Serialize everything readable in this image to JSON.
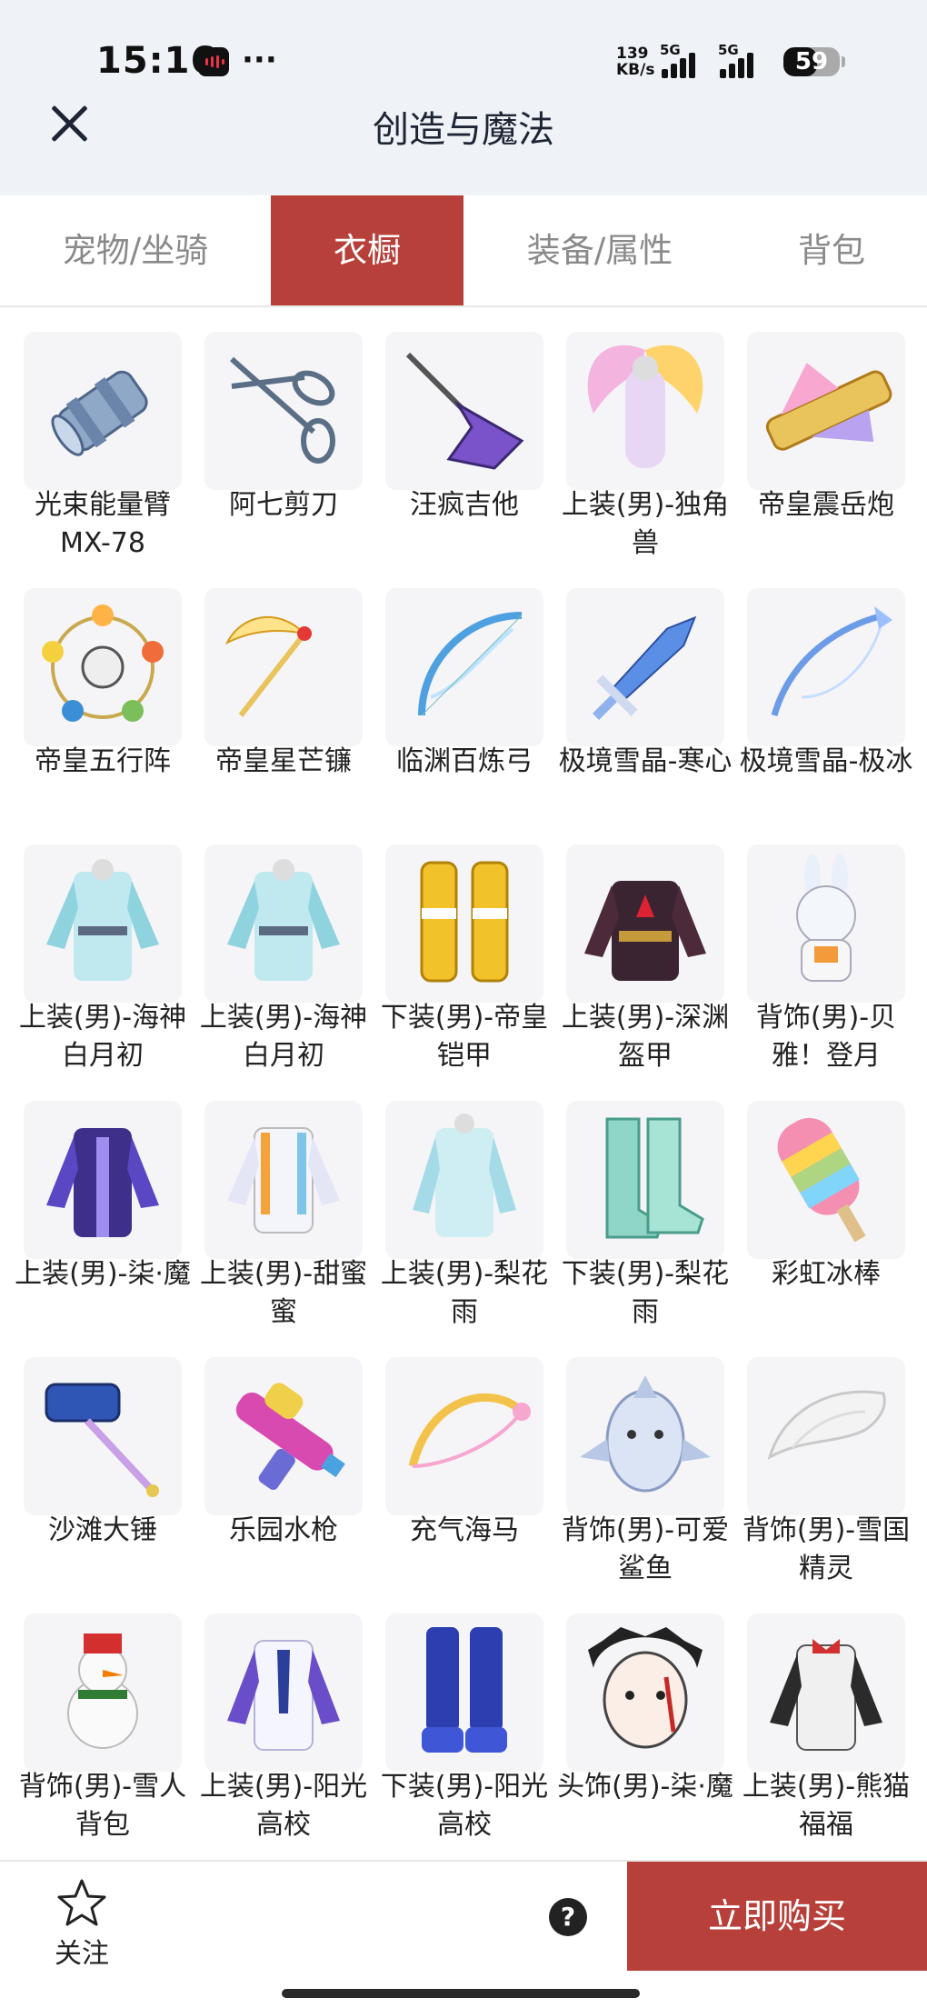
{
  "status_bar": {
    "time": "15:16",
    "net_speed_value": "139",
    "net_speed_unit": "KB/s",
    "network_1": "5G",
    "network_2": "5G",
    "battery": "59",
    "battery_level": 0.59
  },
  "header": {
    "title": "创造与魔法"
  },
  "tabs": [
    {
      "label": "宠物/坐骑",
      "active": false
    },
    {
      "label": "衣橱",
      "active": true
    },
    {
      "label": "装备/属性",
      "active": false
    },
    {
      "label": "背包",
      "active": false
    }
  ],
  "items": [
    {
      "name": "光束能量臂MX-78",
      "icon": "beam-arm-icon"
    },
    {
      "name": "阿七剪刀",
      "icon": "scissors-icon"
    },
    {
      "name": "汪疯吉他",
      "icon": "guitar-icon"
    },
    {
      "name": "上装(男)-独角兽",
      "icon": "unicorn-outfit-icon"
    },
    {
      "name": "帝皇震岳炮",
      "icon": "cannon-icon"
    },
    {
      "name": "帝皇五行阵",
      "icon": "five-elements-ring-icon"
    },
    {
      "name": "帝皇星芒镰",
      "icon": "scythe-icon"
    },
    {
      "name": "临渊百炼弓",
      "icon": "bow-icon"
    },
    {
      "name": "极境雪晶-寒心",
      "icon": "ice-sword-icon"
    },
    {
      "name": "极境雪晶-极冰",
      "icon": "ice-bow-icon"
    },
    {
      "name": "上装(男)-海神白月初",
      "icon": "robe-icon"
    },
    {
      "name": "上装(男)-海神白月初",
      "icon": "robe-icon"
    },
    {
      "name": "下装(男)-帝皇铠甲",
      "icon": "gold-pants-icon"
    },
    {
      "name": "上装(男)-深渊盔甲",
      "icon": "dark-armor-icon"
    },
    {
      "name": "背饰(男)-贝雅！登月",
      "icon": "bunny-astronaut-icon"
    },
    {
      "name": "上装(男)-柒·魔",
      "icon": "purple-coat-icon"
    },
    {
      "name": "上装(男)-甜蜜蜜",
      "icon": "white-shirt-icon"
    },
    {
      "name": "上装(男)-梨花雨",
      "icon": "light-robe-icon"
    },
    {
      "name": "下装(男)-梨花雨",
      "icon": "boots-icon"
    },
    {
      "name": "彩虹冰棒",
      "icon": "popsicle-icon"
    },
    {
      "name": "沙滩大锤",
      "icon": "hammer-icon"
    },
    {
      "name": "乐园水枪",
      "icon": "water-gun-icon"
    },
    {
      "name": "充气海马",
      "icon": "inflatable-bow-icon"
    },
    {
      "name": "背饰(男)-可爱鲨鱼",
      "icon": "shark-icon"
    },
    {
      "name": "背饰(男)-雪国精灵",
      "icon": "wing-icon"
    },
    {
      "name": "背饰(男)-雪人背包",
      "icon": "snowman-icon"
    },
    {
      "name": "上装(男)-阳光高校",
      "icon": "school-uniform-icon"
    },
    {
      "name": "下装(男)-阳光高校",
      "icon": "blue-pants-icon"
    },
    {
      "name": "头饰(男)-柒·魔",
      "icon": "mask-icon"
    },
    {
      "name": "上装(男)-熊猫福福",
      "icon": "panda-jacket-icon"
    }
  ],
  "bottom_bar": {
    "follow_label": "关注",
    "help_label": "?",
    "buy_label": "立即购买"
  }
}
